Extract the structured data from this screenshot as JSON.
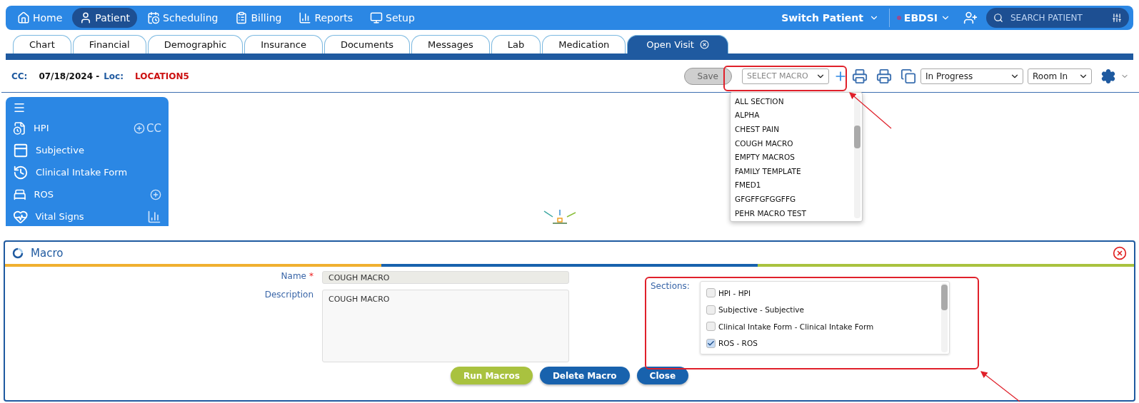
{
  "nav": {
    "items": [
      {
        "label": "Home",
        "selected": false
      },
      {
        "label": "Patient",
        "selected": true
      },
      {
        "label": "Scheduling",
        "selected": false
      },
      {
        "label": "Billing",
        "selected": false
      },
      {
        "label": "Reports",
        "selected": false
      },
      {
        "label": "Setup",
        "selected": false
      }
    ],
    "switch_patient": "Switch Patient",
    "user": "EBDSI",
    "search": {
      "placeholder": "SEARCH PATIENT"
    }
  },
  "tabs": [
    {
      "label": "Chart",
      "selected": false,
      "closable": false
    },
    {
      "label": "Financial",
      "selected": false,
      "closable": false
    },
    {
      "label": "Demographic",
      "selected": false,
      "closable": false
    },
    {
      "label": "Insurance",
      "selected": false,
      "closable": false
    },
    {
      "label": "Documents",
      "selected": false,
      "closable": false
    },
    {
      "label": "Messages",
      "selected": false,
      "closable": false
    },
    {
      "label": "Lab",
      "selected": false,
      "closable": false
    },
    {
      "label": "Medication",
      "selected": false,
      "closable": false
    },
    {
      "label": "Open Visit",
      "selected": true,
      "closable": true
    }
  ],
  "visit_bar": {
    "cc_label": "CC:",
    "date": "07/18/2024 -",
    "loc_label": "Loc:",
    "location": "LOCATION5"
  },
  "toolbar": {
    "save": "Save",
    "save_disabled": true,
    "macro_select": {
      "placeholder": "SELECT MACRO"
    },
    "status": "In Progress",
    "room": "Room In"
  },
  "macro_list": {
    "items": [
      "ALL SECTION",
      "ALPHA",
      "CHEST PAIN",
      "COUGH MACRO",
      "EMPTY MACROS",
      "FAMILY TEMPLATE",
      "FMED1",
      "GFGFFGFGGFFG",
      "PEHR MACRO TEST"
    ]
  },
  "sidebar": {
    "items": [
      {
        "label": "HPI",
        "kind": "add_cc",
        "action_text": "CC"
      },
      {
        "label": "Subjective",
        "kind": "plain"
      },
      {
        "label": "Clinical Intake Form",
        "kind": "plain"
      },
      {
        "label": "ROS",
        "kind": "add"
      },
      {
        "label": "Vital Signs",
        "kind": "chart"
      }
    ]
  },
  "macro_dialog": {
    "title": "Macro",
    "name_label": "Name",
    "required_mark": "*",
    "name_value": "COUGH MACRO",
    "description_label": "Description",
    "description_value": "COUGH MACRO",
    "sections_label": "Sections:",
    "sections": [
      {
        "label": "HPI - HPI",
        "checked": false
      },
      {
        "label": "Subjective - Subjective",
        "checked": false
      },
      {
        "label": "Clinical Intake Form - Clinical Intake Form",
        "checked": false
      },
      {
        "label": "ROS - ROS",
        "checked": true
      }
    ],
    "buttons": [
      {
        "label": "Run Macros",
        "kind": "run"
      },
      {
        "label": "Delete Macro",
        "kind": "delete"
      },
      {
        "label": "Close",
        "kind": "close"
      }
    ]
  }
}
